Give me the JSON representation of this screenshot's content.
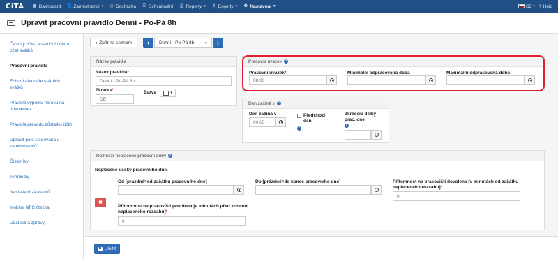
{
  "navbar": {
    "logo": "CiTA",
    "items": [
      {
        "label": "Dashboard",
        "icon": "dashboard-icon",
        "glyph": "▦"
      },
      {
        "label": "Zaměstnanci",
        "icon": "users-icon",
        "glyph": "👤",
        "caret": "▾"
      },
      {
        "label": "Docházka",
        "icon": "clock-icon",
        "glyph": "◷"
      },
      {
        "label": "Schvalování",
        "icon": "check-icon",
        "glyph": "☑"
      },
      {
        "label": "Reporty",
        "icon": "print-icon",
        "glyph": "⎙",
        "caret": "▾"
      },
      {
        "label": "Exporty",
        "icon": "export-icon",
        "glyph": "⇪",
        "caret": "▾"
      },
      {
        "label": "Nastavení",
        "icon": "gear-icon",
        "glyph": "⚙",
        "caret": "▾"
      }
    ],
    "language": "CZ",
    "language_caret": "▾",
    "help": "Help",
    "help_glyph": "?"
  },
  "page": {
    "title": "Upravit pracovní pravidlo Denní - Po-Pá 8h"
  },
  "sidebar": {
    "items": [
      {
        "label": "Časový účet, absenční účet a účet svátků"
      },
      {
        "label": "Pracovní pravidla"
      },
      {
        "label": "Editor kalendáře státních svátků"
      },
      {
        "label": "Pravidla výpočtu nároku na dovolenou"
      },
      {
        "label": "Pravidla převodu zůstatku účtů"
      },
      {
        "label": "Upravit pole sledovaná u zaměstnanců"
      },
      {
        "label": "Číselníky"
      },
      {
        "label": "Terminály"
      },
      {
        "label": "Nastavení záznamů"
      },
      {
        "label": "Mobilní NFC čtečka"
      },
      {
        "label": "Události a zprávy"
      }
    ]
  },
  "toolbar": {
    "back_label": "Zpět na seznam",
    "back_glyph": "‹",
    "prev_glyph": "‹",
    "next_glyph": "›",
    "selected_rule": "Denní - Po-Pá 8h",
    "select_caret": "▾"
  },
  "rule_name": {
    "header": "Název pravidla",
    "name_label": "Název pravidla",
    "name_value": "Denní - Po-Pá 8h",
    "abbr_label": "Zkratka",
    "abbr_value": "DE",
    "color_label": "Barva",
    "color_caret": "▾"
  },
  "workload": {
    "header": "Pracovní úvazek",
    "workload_label": "Pracovní úvazek",
    "workload_value": "08:00",
    "min_label": "Minimální odpracovaná doba",
    "min_value": "",
    "max_label": "Maximální odpracovaná doba",
    "max_value": ""
  },
  "day_start": {
    "header": "Den začíná v",
    "start_label": "Den začíná v",
    "start_value": "00:00",
    "prev_day_label": "Předchozí den",
    "shorten_label": "Zkrácení délky prac. dne",
    "shorten_value": ""
  },
  "unpaid": {
    "header": "Rozmezí neplacené pracovní doby",
    "subtitle": "Neplacené úseky pracovního dne.",
    "from_label": "Od [prázdné=od začátku pracovního dne]",
    "from_value": "",
    "to_label": "Do [prázdné=do konce pracovního dne]",
    "to_value": "",
    "presence_after_label": "Přítomnost na pracovišti dovolena [v minutách od začátku neplaceného rozsahu]",
    "presence_after_value": "0",
    "presence_before_label": "Přítomnost na pracovišti povolena [v minutách před koncem neplaceného rozsahu]",
    "presence_before_value": "0",
    "delete_glyph": "✖"
  },
  "footer": {
    "save_label": "Uložit"
  },
  "colors": {
    "navbar": "#1f4f86",
    "accent": "#2e6cb8",
    "highlight": "#e0202e",
    "danger": "#d9534f"
  },
  "info_glyph": "i",
  "required_mark": "*"
}
